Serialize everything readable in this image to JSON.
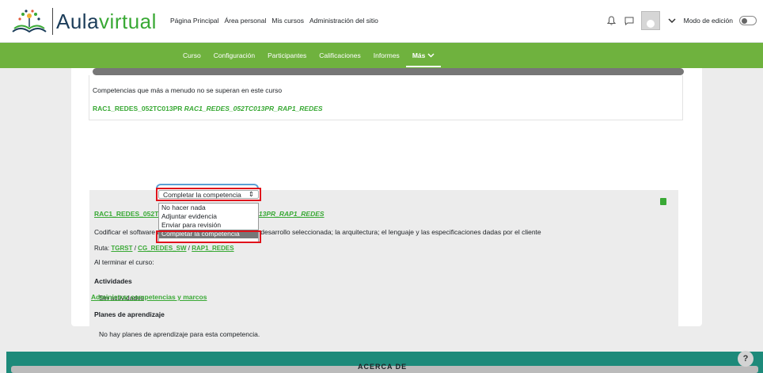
{
  "brand": {
    "part1": "Aula",
    "part2": "virtual"
  },
  "primary_nav": [
    "Página Principal",
    "Área personal",
    "Mis cursos",
    "Administración del sitio"
  ],
  "top_right": {
    "edit_mode_label": "Modo de edición"
  },
  "secondary_nav": [
    "Curso",
    "Configuración",
    "Participantes",
    "Calificaciones",
    "Informes",
    "Más"
  ],
  "summary": {
    "heading": "Competencias que más a menudo no se superan en este curso",
    "item_code": "RAC1_REDES_052TC013PR",
    "item_name": "RAC1_REDES_052TC013PR_RAP1_REDES"
  },
  "competency": {
    "title_code": "RAC1_REDES_052TC013PR",
    "title_name": "RAC1_REDES_052TC013PR_RAP1_REDES",
    "description": "Codificar el software de acuerdo con la metodología de desarrollo seleccionada; la arquitectura; el lenguaje y las especificaciones dadas por el cliente",
    "ruta_label": "Ruta:",
    "ruta_parts": [
      "TGRST",
      "CG_REDES_SW",
      "RAP1_REDES"
    ],
    "ruta_sep": "/",
    "on_complete_label": "Al terminar el curso:",
    "on_complete_value": "Completar la competencia",
    "activities_heading": "Actividades",
    "no_activities": "Sin actividades",
    "plans_heading": "Planes de aprendizaje",
    "no_plans": "No hay planes de aprendizaje para esta competencia."
  },
  "dropdown_options": [
    "No hacer nada",
    "Adjuntar evidencia",
    "Enviar para revisión",
    "Completar la competencia"
  ],
  "admin_link": "Administrar competencias y marcos",
  "footer": {
    "text": "ACERCA DE",
    "help": "?"
  }
}
